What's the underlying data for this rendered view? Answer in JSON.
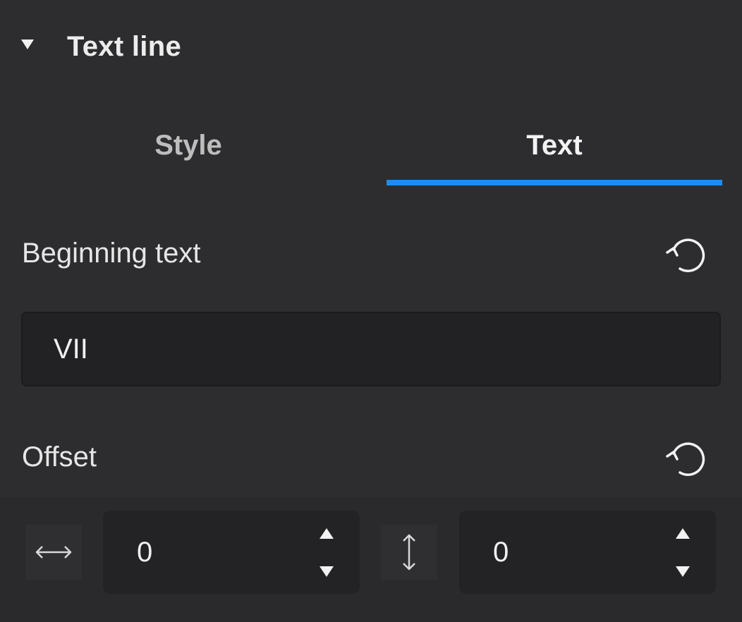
{
  "section": {
    "title": "Text line",
    "expanded": true
  },
  "tabs": [
    {
      "label": "Style",
      "active": false
    },
    {
      "label": "Text",
      "active": true
    }
  ],
  "colors": {
    "accent": "#1e8cf0",
    "background": "#2d2d30",
    "input_background": "#222224"
  },
  "beginning_text": {
    "label": "Beginning text",
    "value": "VII",
    "reset_icon": "reset-icon"
  },
  "offset": {
    "label": "Offset",
    "reset_icon": "reset-icon",
    "horizontal": {
      "icon": "horizontal-arrows-icon",
      "value": "0"
    },
    "vertical": {
      "icon": "vertical-arrows-icon",
      "value": "0"
    }
  }
}
